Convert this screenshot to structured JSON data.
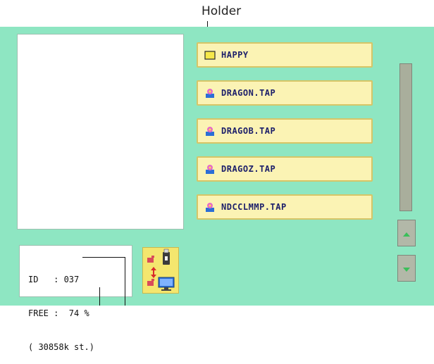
{
  "callout": {
    "holder_label": "Holder"
  },
  "file_list": {
    "items": [
      {
        "label": "HAPPY",
        "icon": "folder-icon"
      },
      {
        "label": "DRAGON.TAP",
        "icon": "design-file-icon"
      },
      {
        "label": "DRAGOB.TAP",
        "icon": "design-file-icon"
      },
      {
        "label": "DRAGOZ.TAP",
        "icon": "design-file-icon"
      },
      {
        "label": "NDCCLMMP.TAP",
        "icon": "design-file-icon"
      }
    ]
  },
  "info_panel": {
    "id_line": "ID   : 037",
    "free_line": "FREE :  74 %",
    "stitch_line": "( 30858k st.)"
  },
  "colors": {
    "screen_bg": "#8ee6c2",
    "button_bg": "#fbf3b4",
    "button_border": "#d6c567",
    "button_text": "#1c1f6a",
    "scroll_arrow": "#3bbf5a",
    "transfer_bg": "#f4e66e"
  }
}
